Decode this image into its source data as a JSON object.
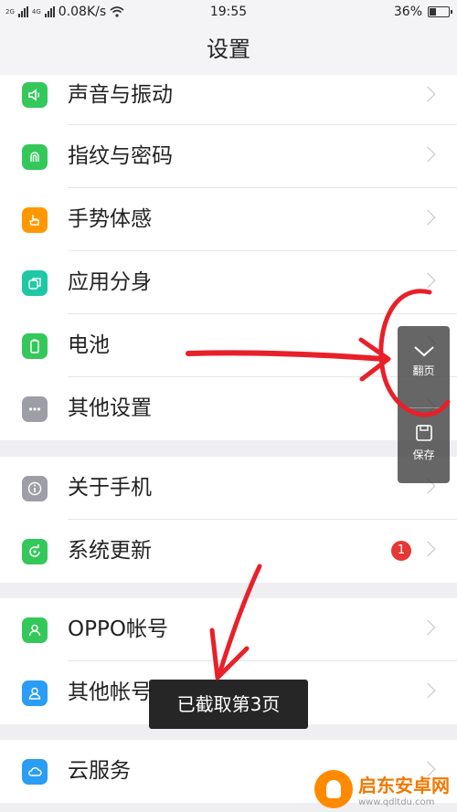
{
  "status_bar": {
    "signal_label_1": "2G",
    "signal_label_2": "4G",
    "network_speed": "0.08K/s",
    "time": "19:55",
    "battery": "36%",
    "battery_level": 0.36,
    "icons": [
      "signal-icon",
      "signal-icon",
      "wifi-icon",
      "battery-icon"
    ]
  },
  "header": {
    "title": "设置"
  },
  "groups": [
    {
      "items": [
        {
          "label": "声音与振动",
          "icon": "speaker-icon",
          "color": "#34c85a"
        },
        {
          "label": "指纹与密码",
          "icon": "fingerprint-icon",
          "color": "#34c85a"
        },
        {
          "label": "手势体感",
          "icon": "gesture-hand-icon",
          "color": "#ff9800"
        },
        {
          "label": "应用分身",
          "icon": "app-clone-icon",
          "color": "#1ec8a5"
        },
        {
          "label": "电池",
          "icon": "battery-icon",
          "color": "#34c85a"
        },
        {
          "label": "其他设置",
          "icon": "more-dots-icon",
          "color": "#9e9ea6"
        }
      ]
    },
    {
      "items": [
        {
          "label": "关于手机",
          "icon": "info-icon",
          "color": "#9e9ea6"
        },
        {
          "label": "系统更新",
          "icon": "update-icon",
          "color": "#34c85a",
          "badge": "1"
        }
      ]
    },
    {
      "items": [
        {
          "label": "OPPO帐号",
          "icon": "user-icon",
          "color": "#34c85a"
        },
        {
          "label": "其他帐号",
          "icon": "user-icon",
          "color": "#2a9df4"
        }
      ]
    },
    {
      "items": [
        {
          "label": "云服务",
          "icon": "cloud-icon",
          "color": "#2a9df4"
        }
      ]
    }
  ],
  "side_panel": {
    "page_flip_label": "翻页",
    "save_label": "保存"
  },
  "toast": {
    "text": "已截取第3页"
  },
  "watermark": {
    "site_name": "启东安卓网",
    "url": "www.qdltdu.com"
  },
  "colors": {
    "annotation": "#e8202a",
    "accent_green": "#34c85a",
    "badge_red": "#e53935"
  }
}
